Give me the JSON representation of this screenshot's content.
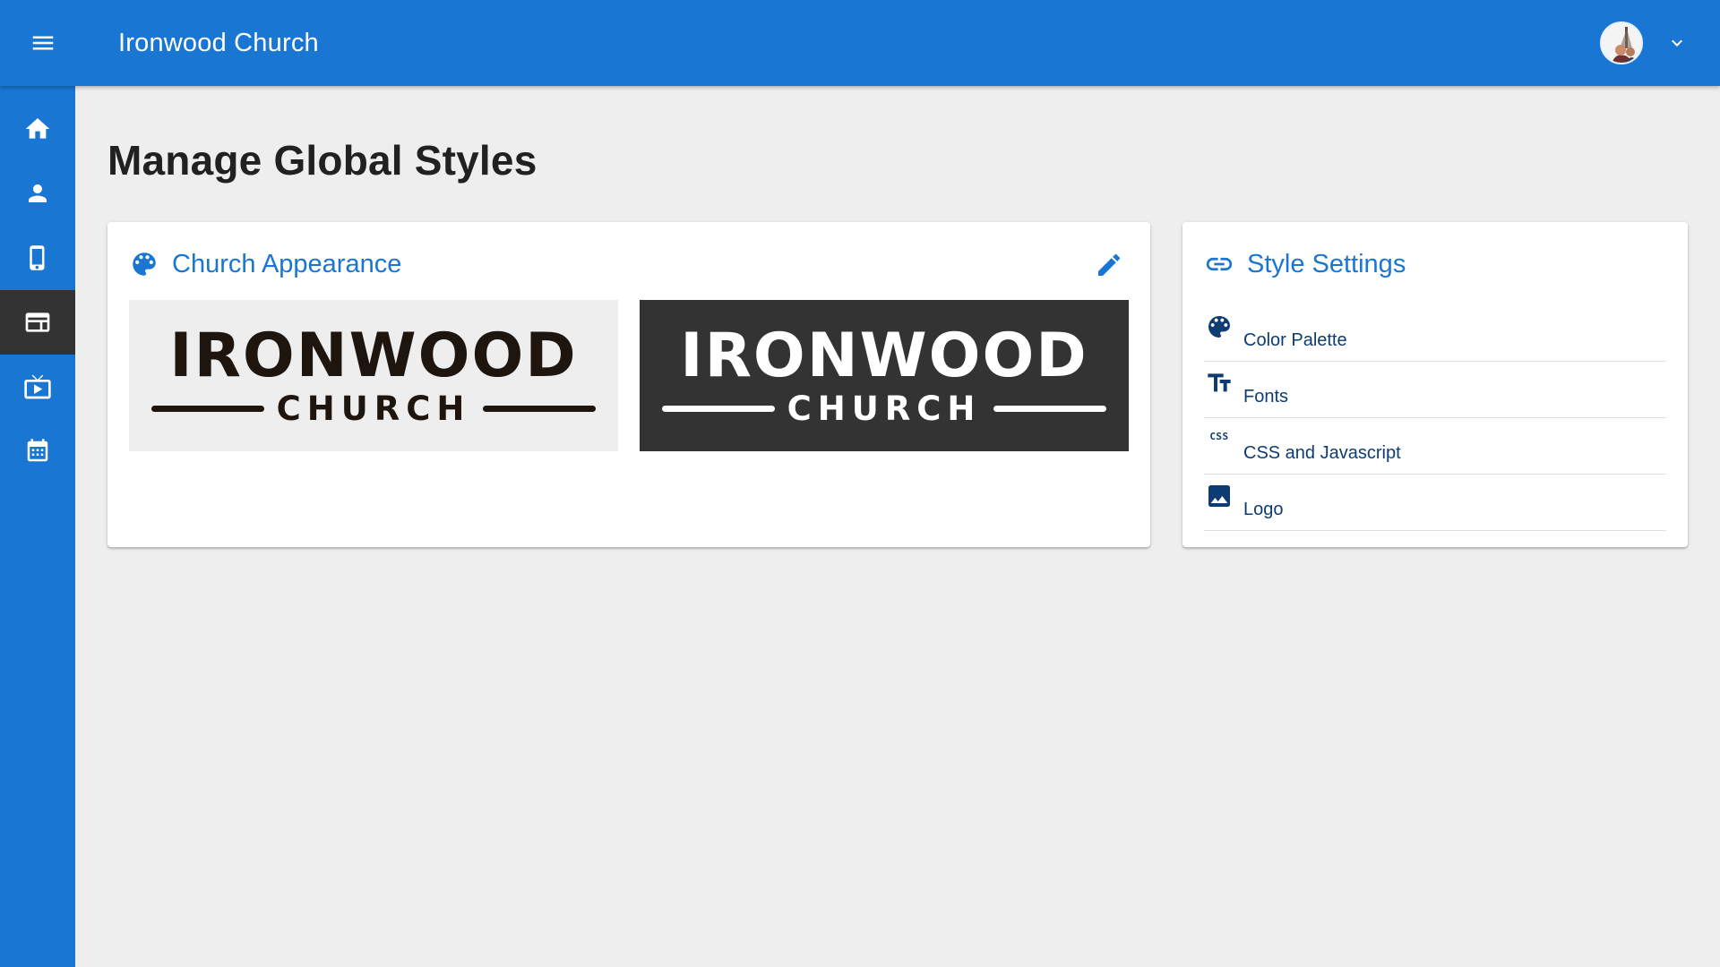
{
  "app": {
    "title": "Ironwood Church"
  },
  "appbar": {
    "menu_icon": "menu-icon",
    "avatar_icon": "user-avatar",
    "chevron_icon": "chevron-down-icon"
  },
  "sidenav": {
    "items": [
      {
        "icon": "home-icon",
        "active": false
      },
      {
        "icon": "person-icon",
        "active": false
      },
      {
        "icon": "mobile-icon",
        "active": false
      },
      {
        "icon": "web-layout-icon",
        "active": true
      },
      {
        "icon": "live-tv-icon",
        "active": false
      },
      {
        "icon": "calendar-icon",
        "active": false
      }
    ]
  },
  "page": {
    "title": "Manage Global Styles"
  },
  "appearance_card": {
    "title": "Church Appearance",
    "title_icon": "palette-icon",
    "edit_icon": "edit-icon",
    "logo_light": {
      "word": "IRONWOOD",
      "sub": "CHURCH"
    },
    "logo_dark": {
      "word": "IRONWOOD",
      "sub": "CHURCH"
    }
  },
  "settings_card": {
    "title": "Style Settings",
    "title_icon": "link-icon",
    "items": [
      {
        "label": "Color Palette",
        "icon": "palette-icon"
      },
      {
        "label": "Fonts",
        "icon": "text-fields-icon"
      },
      {
        "label": "CSS and Javascript",
        "icon": "css-icon",
        "icon_text": "CSS"
      },
      {
        "label": "Logo",
        "icon": "image-icon"
      }
    ]
  },
  "colors": {
    "primary": "#1976d2",
    "active_nav": "#333333",
    "background": "#eeeeee",
    "link_text": "#0d3c73"
  }
}
